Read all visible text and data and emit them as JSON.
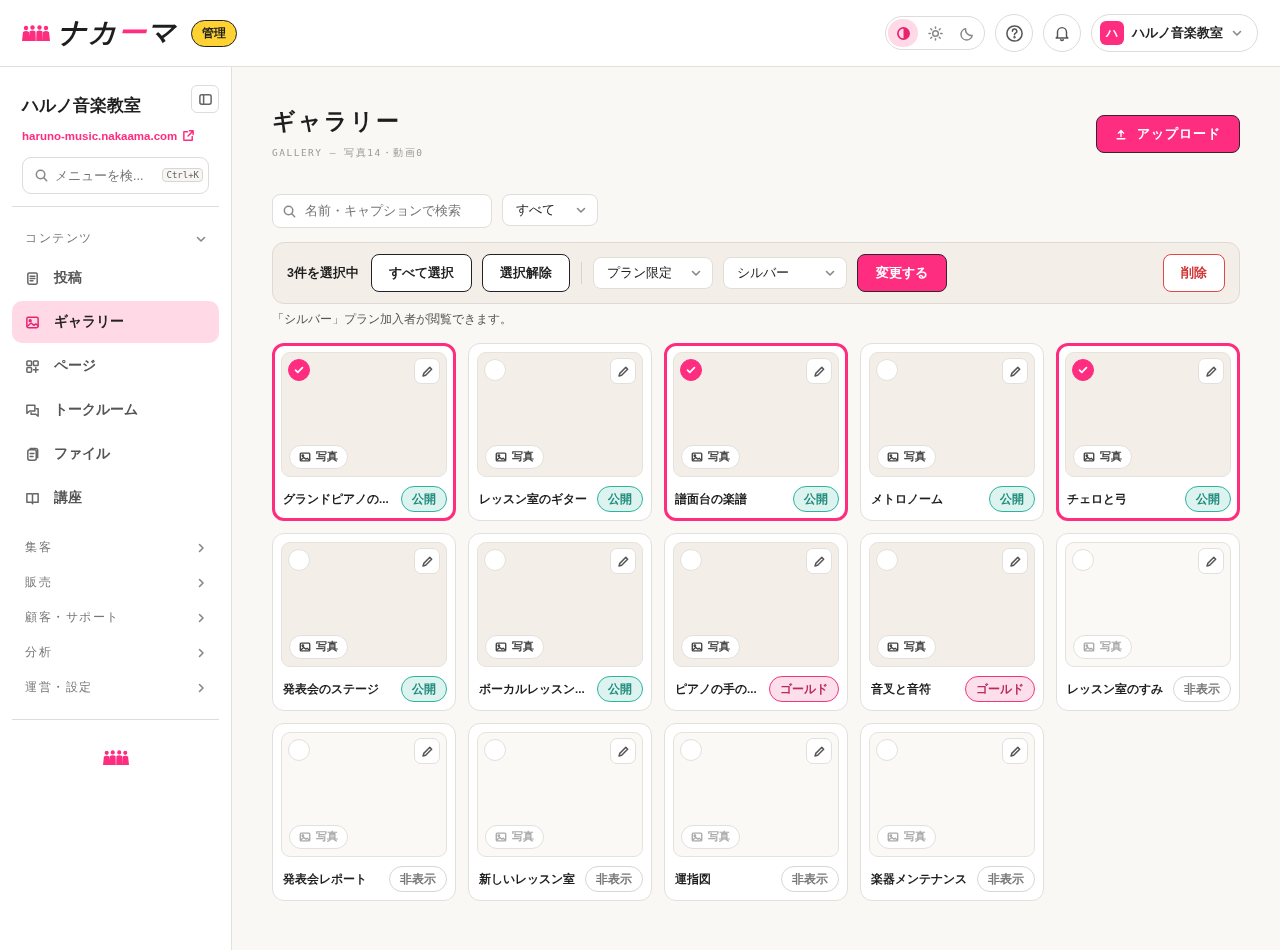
{
  "header": {
    "logo_parts": [
      {
        "text": "ナカ",
        "accent": false
      },
      {
        "text": "ー",
        "accent": true
      },
      {
        "text": "マ",
        "accent": false
      }
    ],
    "role_badge": "管理",
    "theme_modes": [
      {
        "kind": "auto",
        "selected": true
      },
      {
        "kind": "light",
        "selected": false
      },
      {
        "kind": "dark",
        "selected": false
      }
    ],
    "account": {
      "initial": "ハ",
      "name": "ハルノ音楽教室"
    }
  },
  "sidebar": {
    "site_name": "ハルノ音楽教室",
    "site_url": "haruno-music.nakaama.com",
    "search": {
      "placeholder": "メニューを検...",
      "shortcut": "Ctrl+K"
    },
    "sections": [
      {
        "label": "コンテンツ",
        "expanded": true,
        "items": [
          {
            "kind": "posts",
            "label": "投稿",
            "selected": false
          },
          {
            "kind": "gallery",
            "label": "ギャラリー",
            "selected": true
          },
          {
            "kind": "pages",
            "label": "ページ",
            "selected": false
          },
          {
            "kind": "talk",
            "label": "トークルーム",
            "selected": false
          },
          {
            "kind": "files",
            "label": "ファイル",
            "selected": false
          },
          {
            "kind": "courses",
            "label": "講座",
            "selected": false
          }
        ]
      },
      {
        "label": "集客",
        "expanded": false
      },
      {
        "label": "販売",
        "expanded": false
      },
      {
        "label": "顧客・サポート",
        "expanded": false
      },
      {
        "label": "分析",
        "expanded": false
      },
      {
        "label": "運営・設定",
        "expanded": false
      }
    ]
  },
  "page": {
    "title": "ギャラリー",
    "subtitle": "GALLERY — 写真14・動画0",
    "upload_button": "アップロード"
  },
  "filters": {
    "search": {
      "placeholder": "名前・キャプションで検索"
    },
    "type_select": "すべて"
  },
  "bulk_bar": {
    "count_label": "3件を選択中",
    "select_all": "すべて選択",
    "deselect": "選択解除",
    "plan_select": "プラン限定",
    "tier_select": "シルバー",
    "apply": "変更する",
    "delete": "削除"
  },
  "note": "「シルバー」プラン加入者が閲覧できます。",
  "items": [
    {
      "title": "グランドピアノの...",
      "media": "写真",
      "status": "公開",
      "color": "#2bb5a0",
      "hidden": false,
      "selected": true
    },
    {
      "title": "レッスン室のギター",
      "media": "写真",
      "status": "公開",
      "color": "#2bb5a0",
      "hidden": false,
      "selected": false
    },
    {
      "title": "譜面台の楽譜",
      "media": "写真",
      "status": "公開",
      "color": "#2bb5a0",
      "hidden": false,
      "selected": true
    },
    {
      "title": "メトロノーム",
      "media": "写真",
      "status": "公開",
      "color": "#2bb5a0",
      "hidden": false,
      "selected": false
    },
    {
      "title": "チェロと弓",
      "media": "写真",
      "status": "公開",
      "color": "#2bb5a0",
      "hidden": false,
      "selected": true
    },
    {
      "title": "発表会のステージ",
      "media": "写真",
      "status": "公開",
      "color": "#2bb5a0",
      "hidden": false,
      "selected": false
    },
    {
      "title": "ボーカルレッスン...",
      "media": "写真",
      "status": "公開",
      "color": "#2bb5a0",
      "hidden": false,
      "selected": false
    },
    {
      "title": "ピアノの手の...",
      "media": "写真",
      "status": "ゴールド",
      "color": "#f0357f",
      "hidden": false,
      "selected": false
    },
    {
      "title": "音叉と音符",
      "media": "写真",
      "status": "ゴールド",
      "color": "#f0357f",
      "hidden": false,
      "selected": false
    },
    {
      "title": "レッスン室のすみ",
      "media": "写真",
      "status": "非表示",
      "color": "#d8d6d2",
      "hidden": true,
      "selected": false
    },
    {
      "title": "発表会レポート",
      "media": "写真",
      "status": "非表示",
      "color": "#d8d6d2",
      "hidden": true,
      "selected": false
    },
    {
      "title": "新しいレッスン室",
      "media": "写真",
      "status": "非表示",
      "color": "#d8d6d2",
      "hidden": true,
      "selected": false
    },
    {
      "title": "運指図",
      "media": "写真",
      "status": "非表示",
      "color": "#d8d6d2",
      "hidden": true,
      "selected": false
    },
    {
      "title": "楽器メンテナンス",
      "media": "写真",
      "status": "非表示",
      "color": "#d8d6d2",
      "hidden": true,
      "selected": false
    }
  ]
}
